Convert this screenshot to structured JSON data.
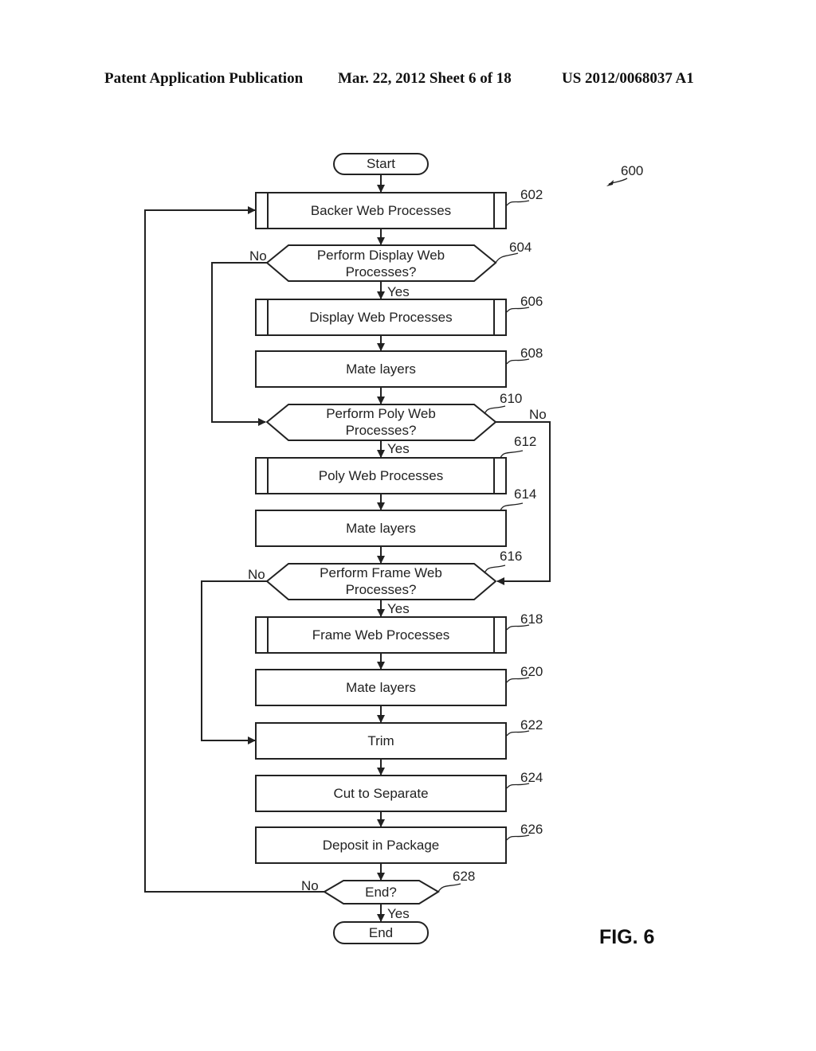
{
  "header": {
    "publication": "Patent Application Publication",
    "date_sheet": "Mar. 22, 2012  Sheet 6 of 18",
    "number": "US 2012/0068037 A1"
  },
  "figure": {
    "label": "FIG. 6",
    "ref": "600"
  },
  "nodes": {
    "start": {
      "text": "Start"
    },
    "n602": {
      "ref": "602",
      "lines": [
        "Backer Web Processes"
      ]
    },
    "n604": {
      "ref": "604",
      "lines": [
        "Perform Display Web",
        "Processes?"
      ]
    },
    "n606": {
      "ref": "606",
      "lines": [
        "Display Web Processes"
      ]
    },
    "n608": {
      "ref": "608",
      "lines": [
        "Mate layers"
      ]
    },
    "n610": {
      "ref": "610",
      "lines": [
        "Perform Poly Web",
        "Processes?"
      ]
    },
    "n612": {
      "ref": "612",
      "lines": [
        "Poly Web Processes"
      ]
    },
    "n614": {
      "ref": "614",
      "lines": [
        "Mate layers"
      ]
    },
    "n616": {
      "ref": "616",
      "lines": [
        "Perform Frame Web",
        "Processes?"
      ]
    },
    "n618": {
      "ref": "618",
      "lines": [
        "Frame Web Processes"
      ]
    },
    "n620": {
      "ref": "620",
      "lines": [
        "Mate layers"
      ]
    },
    "n622": {
      "ref": "622",
      "lines": [
        "Trim"
      ]
    },
    "n624": {
      "ref": "624",
      "lines": [
        "Cut to Separate"
      ]
    },
    "n626": {
      "ref": "626",
      "lines": [
        "Deposit in Package"
      ]
    },
    "n628": {
      "ref": "628",
      "lines": [
        "End?"
      ]
    },
    "end": {
      "text": "End"
    }
  },
  "branch_labels": {
    "yes": "Yes",
    "no": "No"
  }
}
